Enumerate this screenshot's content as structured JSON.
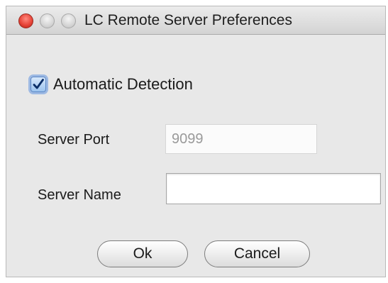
{
  "window": {
    "title": "LC Remote Server Preferences"
  },
  "automatic_detection": {
    "label": "Automatic Detection",
    "checked": true
  },
  "server_port": {
    "label": "Server Port",
    "value": "9099"
  },
  "server_name": {
    "label": "Server Name",
    "value": ""
  },
  "buttons": {
    "ok_label": "Ok",
    "cancel_label": "Cancel"
  },
  "colors": {
    "close_button": "#e8463a",
    "checkbox_accent": "#5e92de"
  }
}
